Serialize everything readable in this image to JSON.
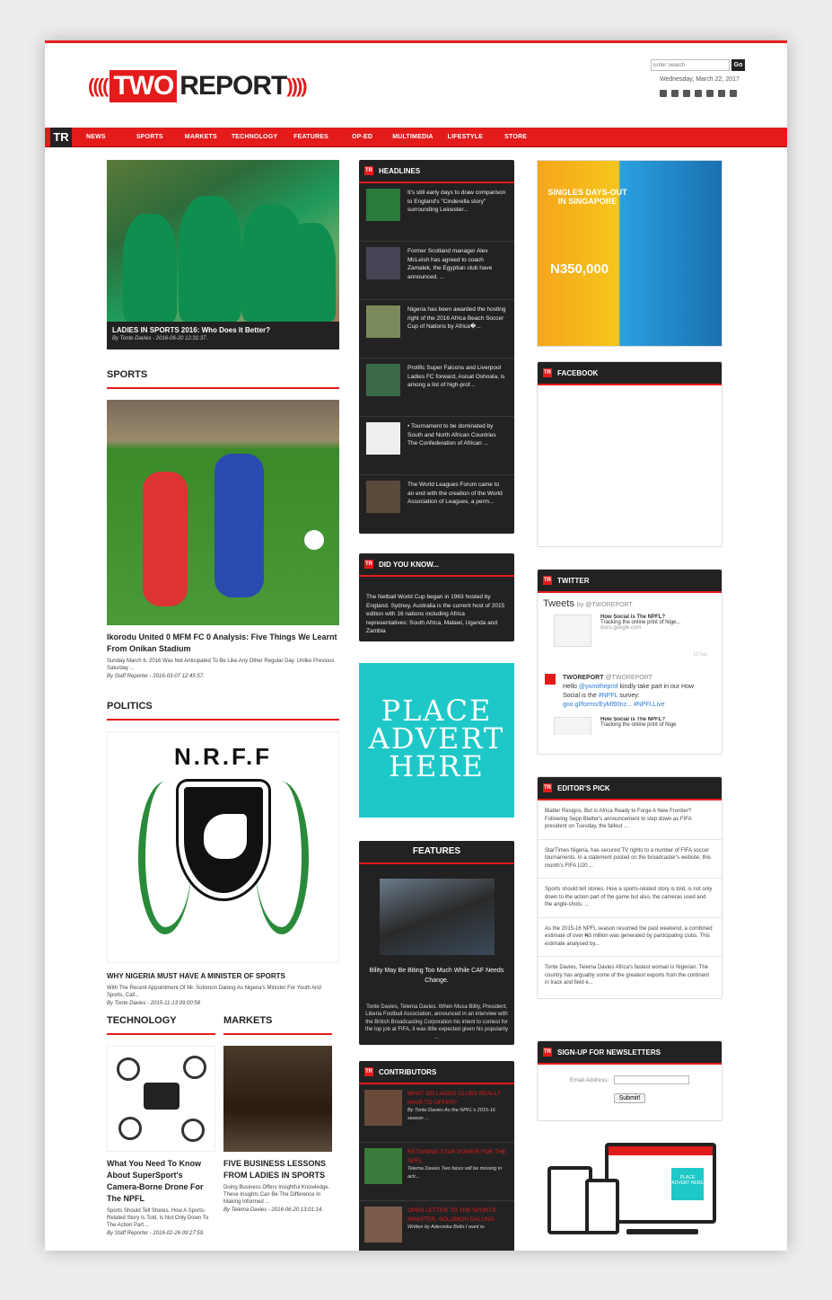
{
  "header": {
    "logo_two": "TWO",
    "logo_report": "REPORT",
    "search_placeholder": "Enter Search",
    "search_button": "Go",
    "date": "Wednesday, March 22, 2017",
    "social_icons": [
      "facebook-icon",
      "twitter-icon",
      "instagram-icon",
      "google-plus-icon",
      "youtube-icon",
      "linkedin-icon",
      "email-icon"
    ]
  },
  "nav": {
    "logo": "TR",
    "items": [
      "NEWS",
      "SPORTS",
      "MARKETS",
      "TECHNOLOGY",
      "FEATURES",
      "OP-ED",
      "MULTIMEDIA",
      "LIFESTYLE",
      "STORE"
    ]
  },
  "hero": {
    "title": "LADIES IN SPORTS 2016: Who Does It Better?",
    "meta": "By Tonte Davies - 2016-06-20 12:31:37."
  },
  "sports": {
    "heading": "SPORTS",
    "title": "Ikorodu United 0 MFM FC 0 Analysis: Five Things We Learnt From Onikan Stadium",
    "desc": "Sunday March 6, 2016 Was Not Anticipated To Be Like Any Other Regular Day. Unlike Previous Saturday ...",
    "meta": "By Staff Reporter - 2016-03-07 12:45:57."
  },
  "politics": {
    "heading": "POLITICS",
    "logo_text": "N.R.F.F",
    "title": "WHY NIGERIA MUST HAVE A MINISTER OF SPORTS",
    "desc": "With The Recent Appointment Of Mr. Solomon Dalong As Nigeria's Minister For Youth And Sports, Call...",
    "meta": "By Tonte Davies - 2015-11-13 09:00:58"
  },
  "technology": {
    "heading": "TECHNOLOGY",
    "title": "What You Need To Know About SuperSport's Camera-Borne Drone For The NPFL",
    "desc": "Sports Should Tell Stories. How A Sports-Related Story Is Told, Is Not Only Down To The Action Part ...",
    "meta": "By Staff Reporter - 2016-02-26 09:27:59."
  },
  "markets": {
    "heading": "MARKETS",
    "title": "FIVE BUSINESS LESSONS FROM LADIES IN SPORTS",
    "desc": "Doing Business Offers Insightful Knowledge. These Insights Can Be The Difference In Making Informed ...",
    "meta": "By Telema Davies - 2016-06-20 13:01:14."
  },
  "headlines": {
    "heading": "HEADLINES",
    "items": [
      "It's still early days to draw comparison to England's \"Cinderella story\" surrounding Leicester...",
      "Former Scotland manager Alex McLeish has agreed to coach Zamalek, the Egyptian club have announced. ...",
      "Nigeria has been awarded the hosting right of the 2016 Africa Beach Soccer Cup of Nations by Africa�...",
      "Prolific Super Falcons and Liverpool Ladies FC forward, Asisat Oshoala, is among a list of high-prof...",
      "• Tournament to be dominated by South and North African Countries The Confederation of African ...",
      "The World Leagues Forum came to an end with the creation of the World Association of Leagues, a perm..."
    ]
  },
  "didyouknow": {
    "heading": "DID YOU KNOW...",
    "text": "The Netball World Cup began in 1963 hosted by England. Sydney, Australia is the current host of 2015 edition with 16 nations including Africa representatives: South Africa, Malawi, Uganda and Zambia"
  },
  "advert": {
    "line1": "PLACE",
    "line2": "ADVERT",
    "line3": "HERE"
  },
  "features": {
    "heading": "FEATURES",
    "title": "Bility May Be Biting Too Much While CAF Needs Change.",
    "desc": "Tonte Davies, Telema Davies. When Musa Bility, President, Liberia Football Association, announced in an interview with the British Broadcasting Corporation his intent to contest for the top job at FIFA, it was little expected given his popularity ..."
  },
  "contributors": {
    "heading": "CONTRIBUTORS",
    "items": [
      {
        "title": "WHAT DO LAGOS CLUBS REALLY HAVE TO OFFER?",
        "desc": "By Tonte Davies As the NPFL's 2015-16 season ..."
      },
      {
        "title": "RETAINING STAR POWER FOR THE NPFL",
        "desc": "Telema Davies Two faces will be missing in acti..."
      },
      {
        "title": "OPEN LETTER TO THE SPORTS MINISTER, SOLOMON DALUNG",
        "desc": "Written by Aderonke Bello I want to"
      }
    ]
  },
  "singapore_ad": {
    "title": "SINGLES DAYS-OUT IN SINGAPORE",
    "price": "N350,000"
  },
  "facebook": {
    "heading": "FACEBOOK"
  },
  "twitter": {
    "heading": "TWITTER",
    "tweets_label": "Tweets",
    "by": "by @TWOREPORT",
    "card_title": "How Social is The NPFL?",
    "card_desc": "Tracking the online print of Nige...",
    "card_url": "docs.google.com",
    "card_time": "12 Feb",
    "user": "TWOREPORT",
    "handle": "@TWOREPORT",
    "tweet_pre": "Hello",
    "mention": "@yomitheprof",
    "tweet_mid": "kindly take part in our How Social is the",
    "hashtag": "#NPFL",
    "tweet_post": "survey:",
    "link": "goo.gl/forms/EyMl90nz...",
    "hashtag2": "#NPFLLive",
    "card2_title": "How Social is The NPFL?",
    "card2_desc": "Tracking the online print of Nige"
  },
  "editors_pick": {
    "heading": "EDITOR'S PICK",
    "items": [
      "Blatter Resigns, But is Africa Ready to Forge A New Frontier? Following Sepp Blatter's announcement to step down as FIFA president on Tuesday, the fallout ...",
      "StarTimes Nigeria, has secured TV rights to a number of FIFA soccer tournaments. In a statement posted on the broadcaster's website, this month's FIFA U20 ...",
      "Sports should tell stories. How a sports-related story is told, is not only down to the action part of the game but also, the cameras used and the angle-shots. ...",
      "As the 2015-16 NPFL season resumed the past weekend, a combined estimate of over ₦3 million was generated by participating clubs. This estimate analysed by...",
      "Tonte Davies, Telema Davies Africa's fastest woman is Nigerian. The country has arguably some of the greatest exports from the continent in track and field e..."
    ]
  },
  "newsletter": {
    "heading": "SIGN-UP FOR NEWSLETTERS",
    "label": "Email Address:",
    "button": "Submit!"
  },
  "devices_ad": {
    "text": "PLACE ADVERT HERE"
  },
  "colors": {
    "accent": "#e31b1b",
    "dark": "#222222",
    "teal": "#1fc8c8"
  }
}
